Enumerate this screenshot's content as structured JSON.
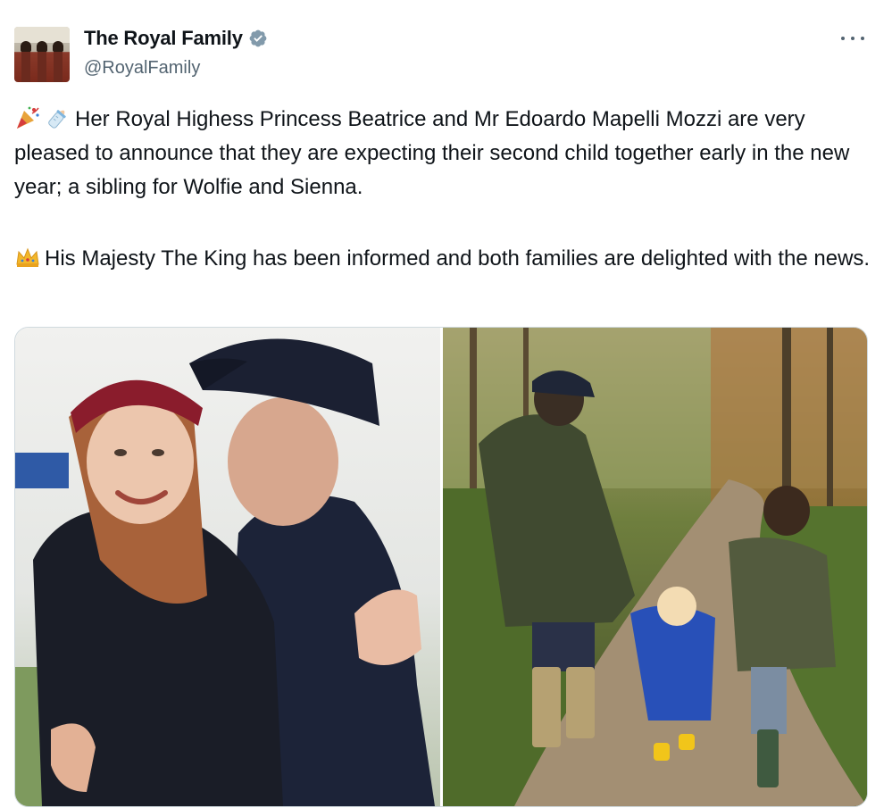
{
  "account": {
    "display_name": "The Royal Family",
    "handle": "@RoyalFamily",
    "verified": true,
    "verified_color": "#829aab"
  },
  "tweet": {
    "paragraph_1": "Her Royal Highess Princess Beatrice and Mr Edoardo Mapelli Mozzi are very pleased to announce that they are expecting their second child together early in the new year; a sibling for Wolfie and Sienna.",
    "paragraph_1_emojis": [
      "party-popper-icon",
      "baby-bottle-icon"
    ],
    "paragraph_2": "His Majesty The King has been informed and both families are delighted with the news.",
    "paragraph_2_emoji": "crown-icon"
  },
  "media": {
    "count": 2,
    "photos": [
      {
        "subject": "couple-embracing-photo"
      },
      {
        "subject": "family-walking-in-woods-photo"
      }
    ]
  },
  "colors": {
    "text": "#0f1419",
    "secondary_text": "#536471",
    "border": "#cfd9de"
  }
}
